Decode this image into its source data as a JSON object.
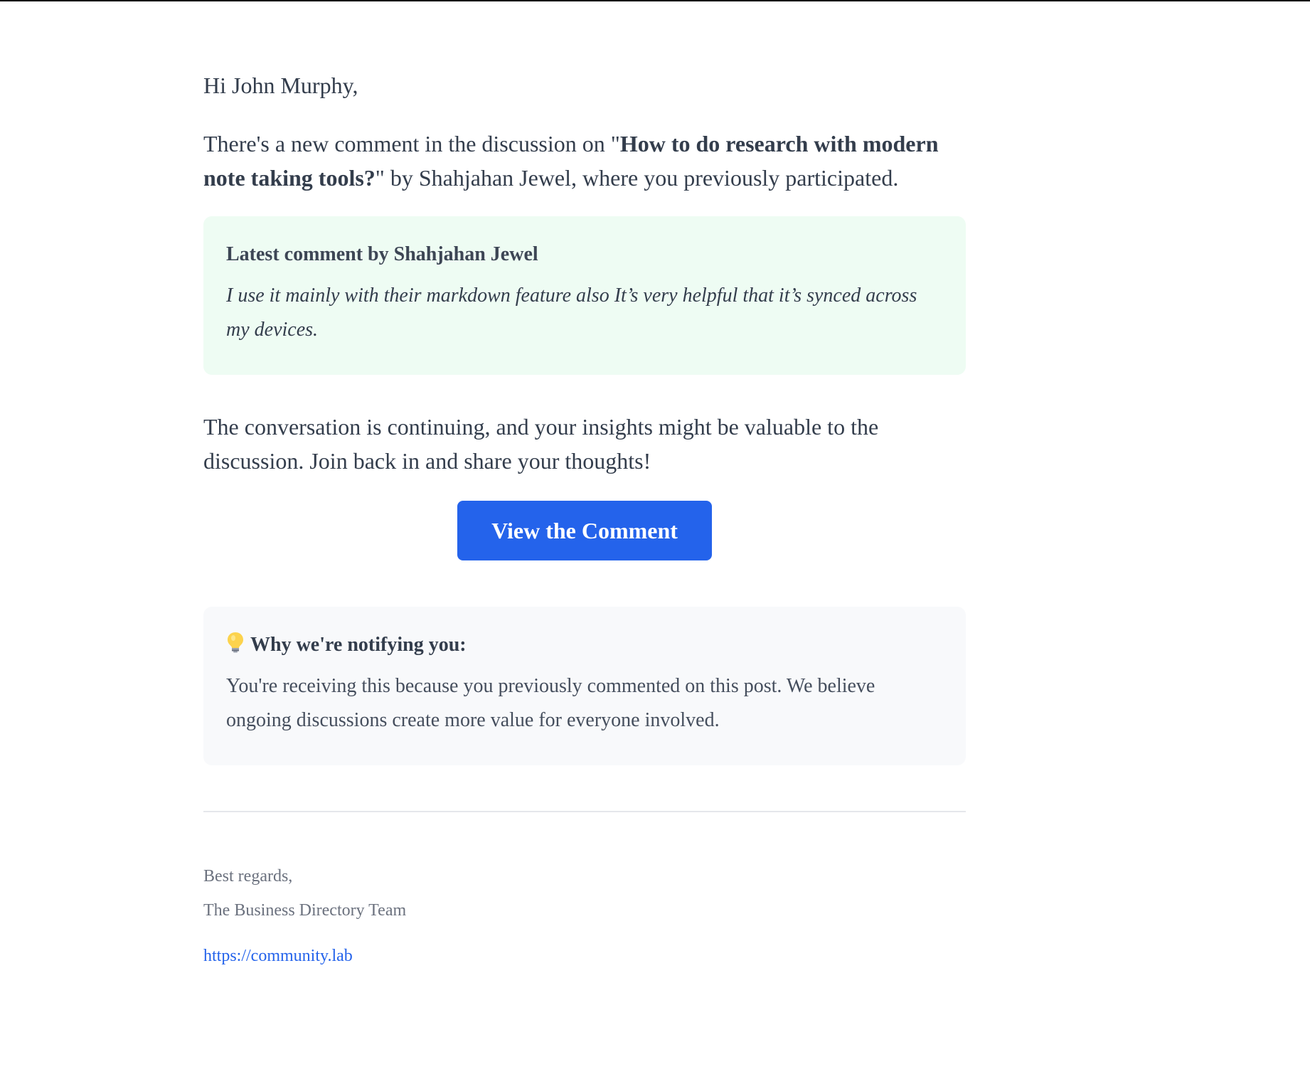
{
  "greeting": "Hi John Murphy,",
  "intro": {
    "prefix": "There's a new comment in the discussion on \"",
    "post_title": "How to do research with modern note taking tools?",
    "suffix": "\" by Shahjahan Jewel, where you previously participated."
  },
  "comment": {
    "title": "Latest comment by Shahjahan Jewel",
    "text": "I use it mainly with their markdown feature also It’s very helpful that it’s synced across my devices."
  },
  "continue_text": "The conversation is continuing, and your insights might be valuable to the discussion. Join back in and share your thoughts!",
  "cta": {
    "label": "View the Comment"
  },
  "why": {
    "icon": "lightbulb-icon",
    "title": "Why we're notifying you:",
    "text": "You're receiving this because you previously commented on this post. We believe ongoing discussions create more value for everyone involved."
  },
  "footer": {
    "regards": "Best regards,",
    "team": "The Business Directory Team",
    "link": "https://community.lab"
  },
  "colors": {
    "accent": "#2463eb",
    "comment_bg": "#eefcf3",
    "info_bg": "#f8f9fb",
    "text": "#333d4c",
    "muted": "#6b717e"
  }
}
